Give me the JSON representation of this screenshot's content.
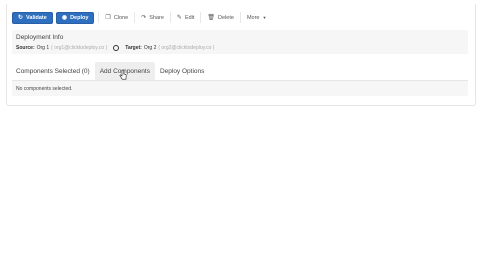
{
  "toolbar": {
    "validate_label": "Validate",
    "deploy_label": "Deploy",
    "clone_label": "Clone",
    "share_label": "Share",
    "edit_label": "Edit",
    "delete_label": "Delete",
    "more_label": "More"
  },
  "deployment_info": {
    "title": "Deployment Info",
    "source_label": "Source:",
    "source_org": "Org 1",
    "source_user": "( org1@clicktodeploy.co )",
    "target_label": "Target:",
    "target_org": "Org 2",
    "target_user": "( org2@clicktodeploy.co )"
  },
  "tabs": [
    {
      "label": "Components Selected (0)"
    },
    {
      "label": "Add Components"
    },
    {
      "label": "Deploy Options"
    }
  ],
  "panel": {
    "empty_text": "No components selected."
  },
  "colors": {
    "primary": "#2f6fbf",
    "panel_bg": "#f6f6f6",
    "active_tab_bg": "#eeeeee"
  },
  "icons": [
    "refresh-icon",
    "deploy-icon",
    "clone-icon",
    "share-icon",
    "edit-icon",
    "trash-icon",
    "caret-down-icon",
    "cursor-icon"
  ]
}
